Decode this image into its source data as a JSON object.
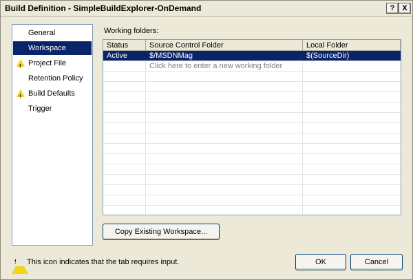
{
  "window": {
    "title": "Build Definition - SimpleBuildExplorer-OnDemand",
    "help_label": "?",
    "close_label": "X"
  },
  "nav": {
    "items": [
      {
        "label": "General",
        "warn": false,
        "selected": false
      },
      {
        "label": "Workspace",
        "warn": false,
        "selected": true
      },
      {
        "label": "Project File",
        "warn": true,
        "selected": false
      },
      {
        "label": "Retention Policy",
        "warn": false,
        "selected": false
      },
      {
        "label": "Build Defaults",
        "warn": true,
        "selected": false
      },
      {
        "label": "Trigger",
        "warn": false,
        "selected": false
      }
    ]
  },
  "workspace": {
    "section_label": "Working folders:",
    "columns": [
      "Status",
      "Source Control Folder",
      "Local Folder"
    ],
    "rows": [
      {
        "status": "Active",
        "source": "$/MSDNMag",
        "local": "$(SourceDir)"
      }
    ],
    "new_row_text": "Click here to enter a new working folder",
    "copy_button": "Copy Existing Workspace..."
  },
  "footer": {
    "hint": "This icon indicates that the tab requires input.",
    "ok": "OK",
    "cancel": "Cancel"
  },
  "colors": {
    "selection": "#0a246a",
    "warning": "#f2d31b",
    "dialog": "#ece9d8"
  }
}
